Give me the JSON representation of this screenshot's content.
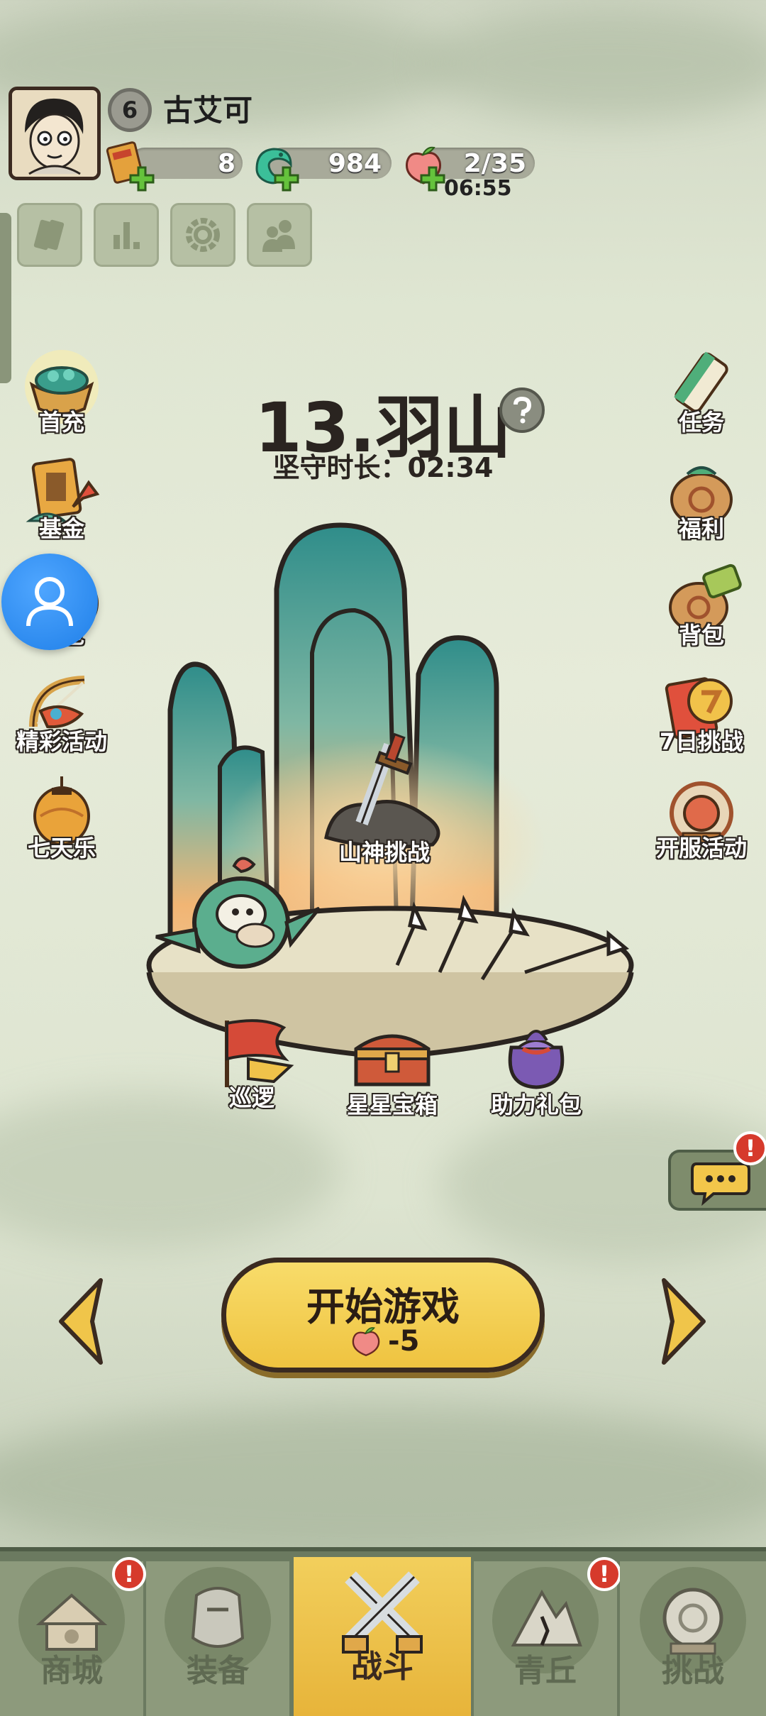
{
  "player": {
    "level": "6",
    "name": "古艾可"
  },
  "resources": {
    "scroll_count": "8",
    "jade_count": "984",
    "stamina": "2/35",
    "stamina_timer": "06:55"
  },
  "stage": {
    "title": "13.羽山",
    "duration_label": "坚守时长：02:34",
    "challenge_label": "山神挑战"
  },
  "left_menu": [
    {
      "label": "首充",
      "icon": "treasure-bowl-icon"
    },
    {
      "label": "基金",
      "icon": "fund-card-icon"
    },
    {
      "label": "礼包",
      "icon": "gift-pack-icon"
    },
    {
      "label": "精彩活动",
      "icon": "bow-icon"
    },
    {
      "label": "七天乐",
      "icon": "lantern-icon"
    }
  ],
  "right_menu": [
    {
      "label": "任务",
      "icon": "scroll-icon"
    },
    {
      "label": "福利",
      "icon": "welfare-bag-icon"
    },
    {
      "label": "背包",
      "icon": "backpack-icon"
    },
    {
      "label": "7日挑战",
      "icon": "seven-day-icon"
    },
    {
      "label": "开服活动",
      "icon": "drum-icon"
    }
  ],
  "island_items": [
    {
      "label": "巡逻",
      "icon": "flag-icon"
    },
    {
      "label": "星星宝箱",
      "icon": "star-chest-icon"
    },
    {
      "label": "助力礼包",
      "icon": "purple-bag-icon"
    }
  ],
  "start_button": {
    "title": "开始游戏",
    "cost": "-5"
  },
  "nav": [
    {
      "label": "商城",
      "icon": "shop-icon",
      "badge": "!"
    },
    {
      "label": "装备",
      "icon": "armor-icon",
      "badge": ""
    },
    {
      "label": "战斗",
      "icon": "crossed-swords-icon",
      "badge": "",
      "active": true
    },
    {
      "label": "青丘",
      "icon": "mountain-icon",
      "badge": "!"
    },
    {
      "label": "挑战",
      "icon": "challenge-orb-icon",
      "badge": ""
    }
  ],
  "chat_badge": "!",
  "colors": {
    "accent_yellow": "#f0c544",
    "nav_green": "#6b7a60",
    "badge_red": "#d63a2c",
    "contact_blue": "#2a88f0"
  }
}
